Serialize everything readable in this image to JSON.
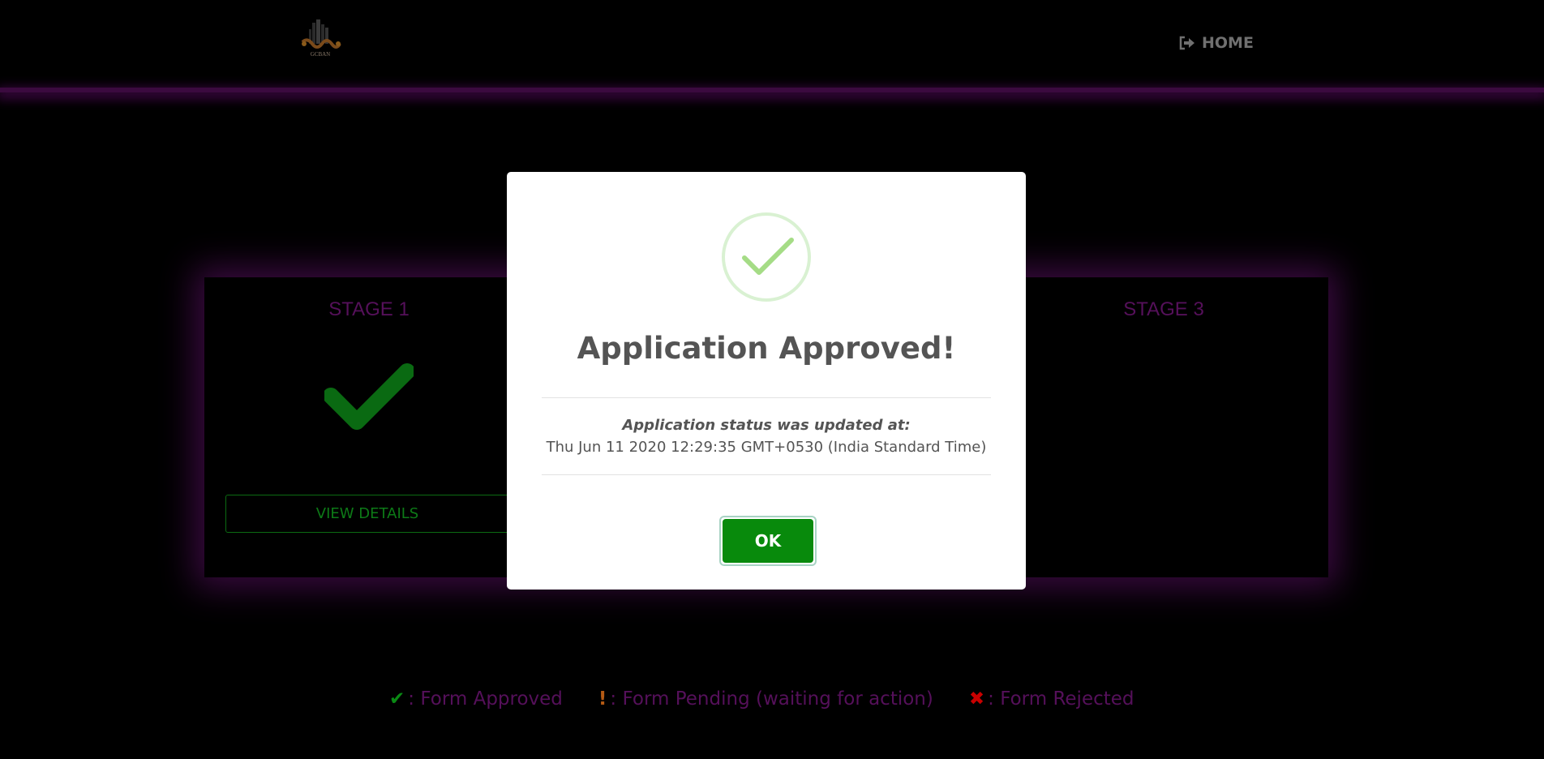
{
  "header": {
    "logo_text": "GCBAN",
    "home_label": "HOME"
  },
  "stages": {
    "stage1": {
      "title": "STAGE 1",
      "status": "approved",
      "button_label": "VIEW DETAILS"
    },
    "stage3": {
      "title": "STAGE 3"
    }
  },
  "legend": {
    "approved_symbol": "✔",
    "approved_label": ": Form Approved",
    "pending_symbol": "!",
    "pending_label": ": Form Pending (waiting for action)",
    "rejected_symbol": "✖",
    "rejected_label": ": Form Rejected"
  },
  "modal": {
    "icon": "success-check-icon",
    "title": "Application Approved!",
    "subtitle": "Application status was updated at:",
    "timestamp": "Thu Jun 11 2020 12:29:35 GMT+0530 (India Standard Time)",
    "ok_label": "OK"
  },
  "colors": {
    "background": "#000000",
    "accent_purple": "#55105a",
    "success_green": "#088a0c",
    "pending_orange": "#b45a14",
    "reject_red": "#c80000"
  }
}
